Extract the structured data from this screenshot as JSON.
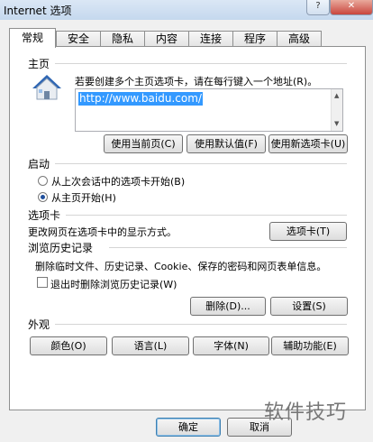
{
  "window": {
    "title": "Internet 选项",
    "help_glyph": "?",
    "close_glyph": "✕"
  },
  "tabs": [
    "常规",
    "安全",
    "隐私",
    "内容",
    "连接",
    "程序",
    "高级"
  ],
  "home": {
    "heading": "主页",
    "instruction": "若要创建多个主页选项卡，请在每行键入一个地址(R)。",
    "url": "http://www.baidu.com/",
    "buttons": [
      "使用当前页(C)",
      "使用默认值(F)",
      "使用新选项卡(U)"
    ]
  },
  "startup": {
    "heading": "启动",
    "options": [
      {
        "label": "从上次会话中的选项卡开始(B)",
        "selected": false
      },
      {
        "label": "从主页开始(H)",
        "selected": true
      }
    ]
  },
  "tabs_section": {
    "heading": "选项卡",
    "desc": "更改网页在选项卡中的显示方式。",
    "button": "选项卡(T)"
  },
  "history": {
    "heading": "浏览历史记录",
    "desc": "删除临时文件、历史记录、Cookie、保存的密码和网页表单信息。",
    "checkbox_label": "退出时删除浏览历史记录(W)",
    "checkbox_checked": false,
    "delete_button": "删除(D)...",
    "settings_button": "设置(S)"
  },
  "appearance": {
    "heading": "外观",
    "buttons": [
      "颜色(O)",
      "语言(L)",
      "字体(N)",
      "辅助功能(E)"
    ]
  },
  "footer": {
    "ok": "确定",
    "cancel": "取消"
  },
  "watermark": "软件技巧"
}
